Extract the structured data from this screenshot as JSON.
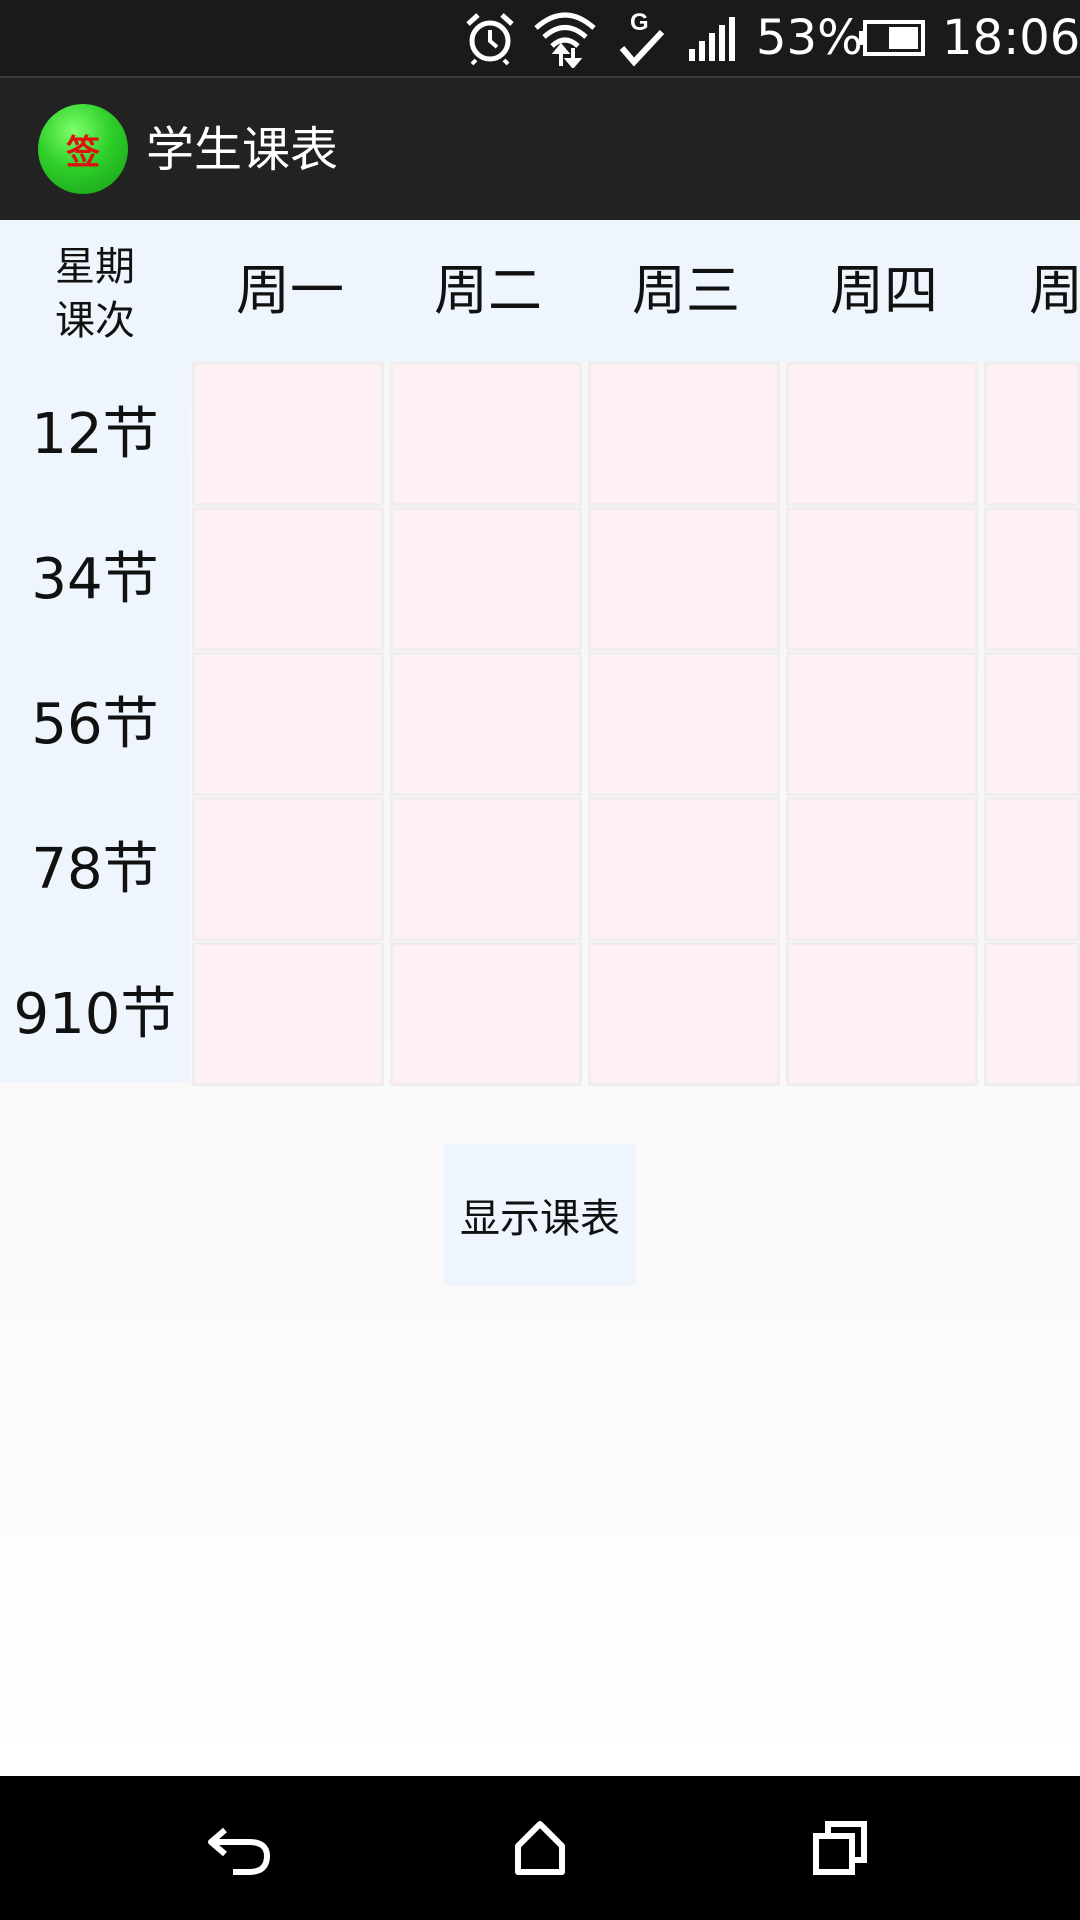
{
  "status_bar": {
    "icons": [
      "alarm-icon",
      "wifi-icon",
      "gps-check-icon",
      "signal-icon",
      "battery-icon"
    ],
    "battery_percent": "53%",
    "time": "18:06"
  },
  "app_bar": {
    "logo_text": "签",
    "title": "学生课表"
  },
  "timetable": {
    "corner_top": "星期",
    "corner_bottom": "课次",
    "days": [
      "周一",
      "周二",
      "周三",
      "周四",
      "周"
    ],
    "periods": [
      "12节",
      "34节",
      "56节",
      "78节",
      "910节"
    ]
  },
  "actions": {
    "show_label": "显示课表"
  },
  "nav_bar": {
    "icons": [
      "back-icon",
      "home-icon",
      "recents-icon"
    ]
  },
  "colors": {
    "status_bar_bg": "#1a1a1a",
    "app_bar_bg": "#222222",
    "header_bg": "#eef5fd",
    "cell_bg": "#fff0f4",
    "logo_green": "#2fcf2a",
    "logo_text": "#e01010"
  }
}
